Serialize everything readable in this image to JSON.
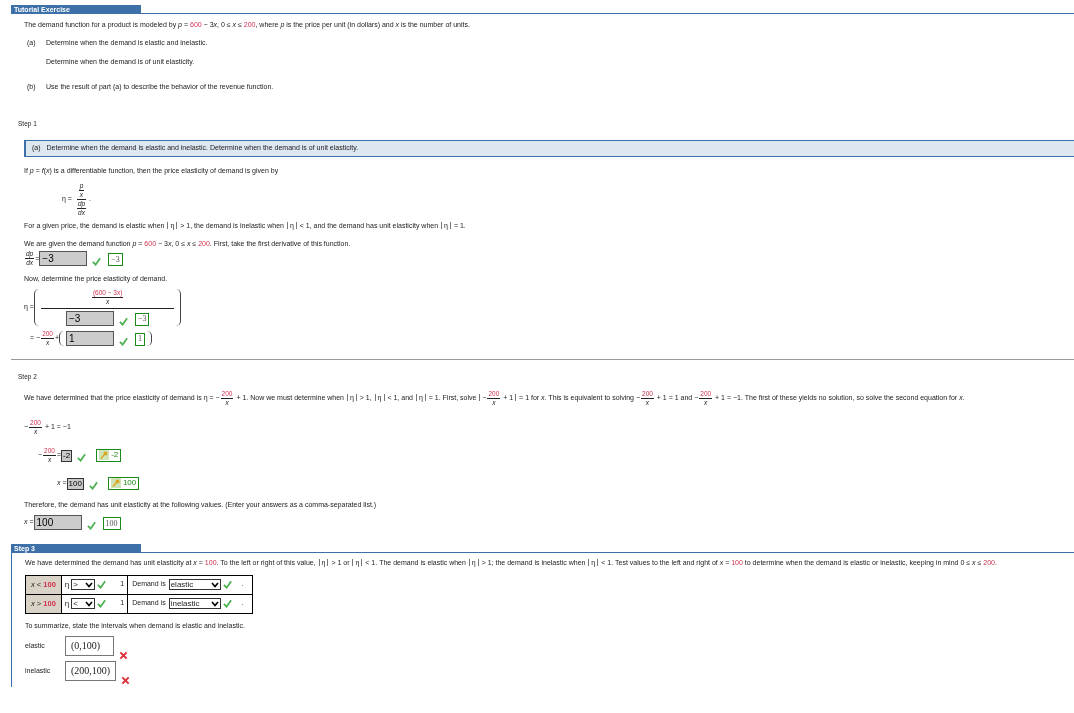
{
  "header": {
    "title": "Tutorial Exercise"
  },
  "problem": {
    "statement": [
      "The demand function for a product is modeled by *p* = ",
      {
        "kind": "red",
        "text": "600"
      },
      " − 3",
      "*x*",
      ", 0 ≤ *x* ≤ ",
      {
        "kind": "red",
        "text": "200"
      },
      ", where *p* is the price per unit (in dollars) and *x* is the number of units."
    ],
    "parts": [
      {
        "label": "(a)",
        "lines": [
          "Determine when the demand is elastic and inelastic.",
          "Determine when the demand is of unit elasticity."
        ]
      },
      {
        "label": "(b)",
        "lines": [
          "Use the result of part (a) to describe the behavior of the revenue function."
        ]
      }
    ]
  },
  "step1": {
    "label": "Step 1",
    "banner_label": "(a)",
    "banner": "Determine when the demand is elastic and inelastic. Determine when the demand is of unit elasticity.",
    "lines": [
      [
        "If *p* = *f*(*x*) is a differentiable function, then the price elasticity of demand is given by"
      ],
      [
        "η = ",
        {
          "kind": "frac",
          "num": [
            {
              "kind": "frac",
              "num": [
                "*p*"
              ],
              "den": [
                "*x*"
              ]
            }
          ],
          "den": [
            {
              "kind": "frac",
              "num": [
                "*dp*"
              ],
              "den": [
                "*dx*"
              ]
            }
          ]
        },
        "."
      ],
      [
        "For a given price, the demand is elastic when ",
        {
          "kind": "abs",
          "parts": [
            "η"
          ]
        },
        " > 1, the demand is inelastic when ",
        {
          "kind": "abs",
          "parts": [
            "η"
          ]
        },
        " < 1, and the demand has unit elasticity when ",
        {
          "kind": "abs",
          "parts": [
            "η"
          ]
        },
        " = 1."
      ],
      [
        "We are given the demand function *p* = ",
        {
          "kind": "red",
          "text": "600"
        },
        " − 3",
        "*x*",
        ", 0 ≤ *x* ≤ ",
        {
          "kind": "red",
          "text": "200"
        },
        ". First, take the first derivative of this function."
      ],
      [
        {
          "kind": "frac",
          "num": [
            "*dp*"
          ],
          "den": [
            "*dx*"
          ]
        },
        " = ",
        {
          "kind": "answer",
          "value": "−3",
          "correct": true,
          "key": "−3",
          "key_icon": false
        }
      ],
      [
        "Now, determine the price elasticity of demand."
      ],
      [
        "η = ",
        {
          "kind": "paren",
          "parts": [
            {
              "kind": "frac",
              "num": [
                {
                  "kind": "frac",
                  "num": [
                    {
                      "kind": "red",
                      "text": "(600 − 3x)"
                    }
                  ],
                  "den": [
                    "*x*"
                  ]
                }
              ],
              "den": [
                {
                  "kind": "answer",
                  "value": "−3",
                  "correct": true,
                  "key": "−3",
                  "key_icon": false
                }
              ]
            }
          ]
        }
      ],
      [
        "= −",
        {
          "kind": "frac",
          "num": [
            {
              "kind": "red",
              "text": "200"
            }
          ],
          "den": [
            "*x*"
          ]
        },
        " + ",
        {
          "kind": "paren",
          "parts": [
            {
              "kind": "answer",
              "value": "1",
              "correct": true,
              "key": "1",
              "key_icon": false
            }
          ]
        }
      ]
    ]
  },
  "step2": {
    "label": "Step 2",
    "lines": [
      [
        "We have determined that the price elasticity of demand is η = −",
        {
          "kind": "frac",
          "num": [
            {
              "kind": "red",
              "text": "200"
            }
          ],
          "den": [
            "*x*"
          ]
        },
        " + 1. Now we must determine when ",
        {
          "kind": "abs",
          "parts": [
            "η"
          ]
        },
        " > 1, ",
        {
          "kind": "abs",
          "parts": [
            "η"
          ]
        },
        " < 1, and ",
        {
          "kind": "abs",
          "parts": [
            "η"
          ]
        },
        " = 1. First, solve ",
        {
          "kind": "abs",
          "parts": [
            "−",
            {
              "kind": "frac",
              "num": [
                {
                  "kind": "red",
                  "text": "200"
                }
              ],
              "den": [
                "*x*"
              ]
            },
            " + 1"
          ]
        },
        " = 1 for *x*. This is equivalent to solving −",
        {
          "kind": "frac",
          "num": [
            {
              "kind": "red",
              "text": "200"
            }
          ],
          "den": [
            "*x*"
          ]
        },
        " + 1 = 1 and −",
        {
          "kind": "frac",
          "num": [
            {
              "kind": "red",
              "text": "200"
            }
          ],
          "den": [
            "*x*"
          ]
        },
        " + 1 = −1. The first of these yields no solution, so solve the second equation for *x*."
      ],
      [
        "−",
        {
          "kind": "frac",
          "num": [
            {
              "kind": "red",
              "text": "200"
            }
          ],
          "den": [
            "*x*"
          ]
        },
        " + 1 = −1"
      ],
      [
        "−",
        {
          "kind": "frac",
          "num": [
            {
              "kind": "red",
              "text": "200"
            }
          ],
          "den": [
            "*x*"
          ]
        },
        " = ",
        {
          "kind": "answer_small",
          "value": "-2",
          "correct": true,
          "key": "-2",
          "key_icon": true
        }
      ],
      [
        "*x* = ",
        {
          "kind": "answer_small",
          "value": "100",
          "correct": true,
          "key": "100",
          "key_icon": true
        }
      ],
      [
        "Therefore, the demand has unit elasticity at the following values. (Enter your answers as a comma-separated list.)"
      ],
      [
        "*x* = ",
        {
          "kind": "answer",
          "value": "100",
          "correct": true,
          "key": "100",
          "key_icon": false
        }
      ]
    ]
  },
  "step3": {
    "label": "Step 3",
    "sentence": [
      "We have determined the demand has unit elasticity at *x* = ",
      {
        "kind": "red",
        "text": "100"
      },
      ". To the left or right of this value, ",
      {
        "kind": "abs",
        "parts": [
          "η"
        ]
      },
      " > 1 or ",
      {
        "kind": "abs",
        "parts": [
          "η"
        ]
      },
      " < 1. The demand is elastic when ",
      {
        "kind": "abs",
        "parts": [
          "η"
        ]
      },
      " > 1; the demand is inelastic when ",
      {
        "kind": "abs",
        "parts": [
          "η"
        ]
      },
      " < 1. Test values to the left and right of *x* = ",
      {
        "kind": "red",
        "text": "100"
      },
      " to determine when the demand is elastic or inelastic, keeping in mind 0 ≤ *x* ≤ ",
      {
        "kind": "red",
        "text": "200"
      },
      "."
    ],
    "rows": [
      {
        "variable": "x",
        "operator": "<",
        "value": "100",
        "eta": "η",
        "comparison": ">",
        "comparison_correct": true,
        "bound": "1",
        "prefix": "Demand is",
        "demand": "elastic",
        "demand_correct": true,
        "suffix": "."
      },
      {
        "variable": "x",
        "operator": ">",
        "value": "100",
        "eta": "η",
        "comparison": "<",
        "comparison_correct": true,
        "bound": "1",
        "prefix": "Demand is",
        "demand": "inelastic",
        "demand_correct": true,
        "suffix": "."
      }
    ],
    "summary": "To summarize, state the intervals when demand is elastic and inelastic.",
    "intervals": [
      {
        "label": "elastic",
        "value": "(0,100)",
        "correct": false
      },
      {
        "label": "inelastic",
        "value": "(200,100)",
        "correct": false
      }
    ]
  }
}
